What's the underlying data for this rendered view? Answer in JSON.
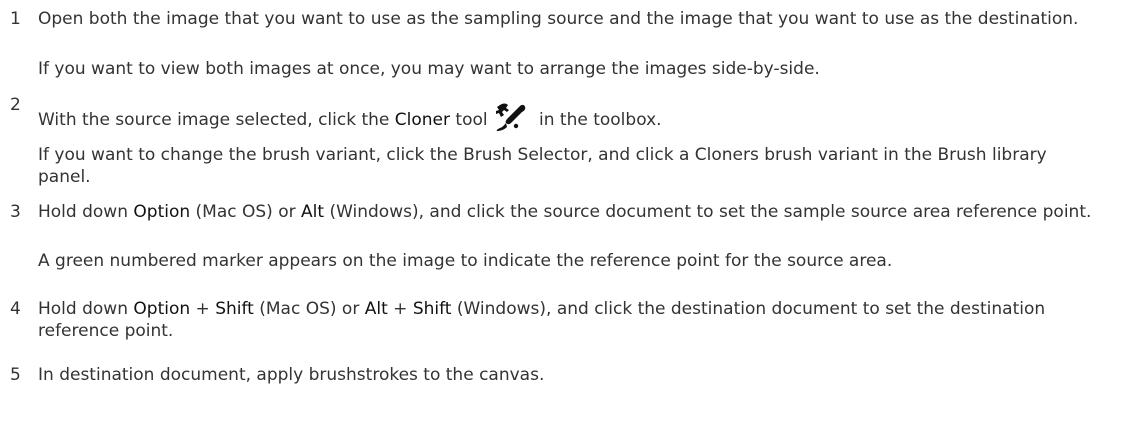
{
  "steps": [
    {
      "number": "1",
      "text": "Open both the image that you want to use as the sampling source and the image that you want to use as the destination.",
      "note": "If you want to view both images at once, you may want to arrange the images side-by-side."
    },
    {
      "number": "2",
      "pre": "With the source image selected, click the ",
      "kw1": "Cloner",
      "mid": " tool",
      "icon": "cloner-tool-icon",
      "post": " in the toolbox.",
      "note": "If you want to change the brush variant, click the Brush Selector, and click a Cloners brush variant in the Brush library panel."
    },
    {
      "number": "3",
      "pre": "Hold down ",
      "kw1": "Option",
      "mid": " (Mac OS) or ",
      "kw2": "Alt",
      "post": " (Windows), and click the source document to set the sample source area reference point.",
      "note": "A green numbered marker appears on the image to indicate the reference point for the source area."
    },
    {
      "number": "4",
      "pre": "Hold down ",
      "kw1": "Option",
      "plus1": " + ",
      "kw2": "Shift",
      "mid": " (Mac OS) or ",
      "kw3": "Alt",
      "plus2": " + ",
      "kw4": "Shift",
      "post": " (Windows), and click the destination document to set the destination reference point."
    },
    {
      "number": "5",
      "text": "In destination document, apply brushstrokes to the canvas."
    }
  ]
}
